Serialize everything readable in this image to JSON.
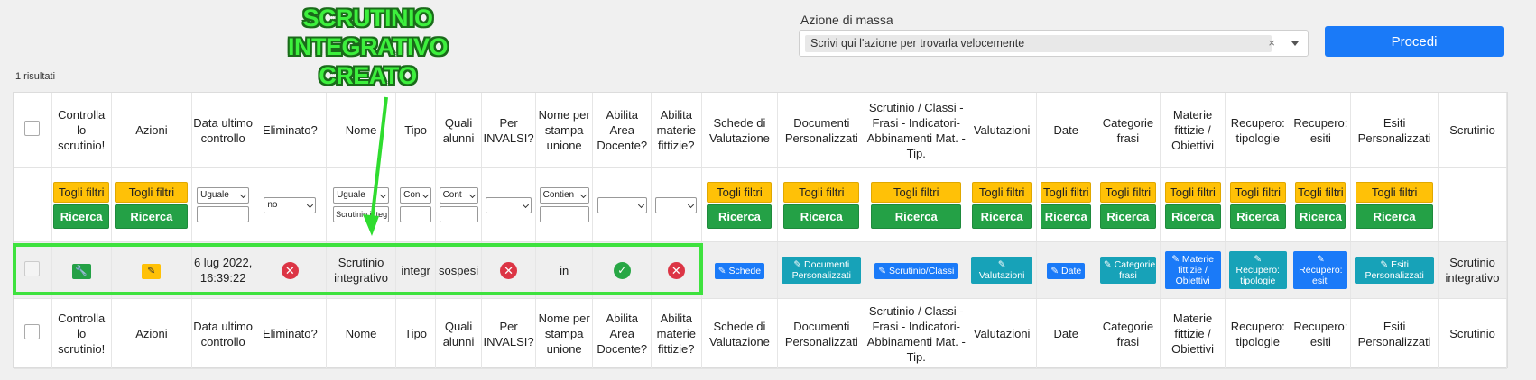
{
  "mass_action": {
    "label": "Azione di massa",
    "placeholder": "Scrivi qui l'azione per trovarla velocemente",
    "clear_symbol": "×",
    "proceed_label": "Procedi"
  },
  "results_count": "1 risultati",
  "annotation": {
    "lines": [
      "SCRUTINIO",
      "INTEGRATIVO",
      "CREATO"
    ],
    "color": "#3df03d"
  },
  "columns": [
    {
      "key": "check",
      "label": ""
    },
    {
      "key": "controlla",
      "label": "Controlla lo scrutinio!"
    },
    {
      "key": "azioni",
      "label": "Azioni"
    },
    {
      "key": "data",
      "label": "Data ultimo controllo"
    },
    {
      "key": "eliminato",
      "label": "Eliminato?"
    },
    {
      "key": "nome",
      "label": "Nome"
    },
    {
      "key": "tipo",
      "label": "Tipo"
    },
    {
      "key": "quali",
      "label": "Quali alunni"
    },
    {
      "key": "invalsi",
      "label": "Per INVALSI?"
    },
    {
      "key": "nome_stampa",
      "label": "Nome per stampa unione"
    },
    {
      "key": "area",
      "label": "Abilita Area Docente?"
    },
    {
      "key": "materie",
      "label": "Abilita materie fittizie?"
    },
    {
      "key": "schede",
      "label": "Schede di Valutazione"
    },
    {
      "key": "documenti",
      "label": "Documenti Personalizzati"
    },
    {
      "key": "classi",
      "label": "Scrutinio / Classi - Frasi - Indicatori- Abbinamenti Mat. - Tip."
    },
    {
      "key": "valutazioni",
      "label": "Valutazioni"
    },
    {
      "key": "date",
      "label": "Date"
    },
    {
      "key": "categorie",
      "label": "Categorie frasi"
    },
    {
      "key": "materie_fitt",
      "label": "Materie fittizie / Obiettivi"
    },
    {
      "key": "rec_tip",
      "label": "Recupero: tipologie"
    },
    {
      "key": "rec_esiti",
      "label": "Recupero: esiti"
    },
    {
      "key": "esiti",
      "label": "Esiti Personalizzati"
    },
    {
      "key": "scrutinio",
      "label": "Scrutinio"
    }
  ],
  "footer_labels": {
    "classi": "Scrutinio / Classi - Frasi - Indicatori- Abbinamenti Mat. - Tip."
  },
  "filters": {
    "remove_label": "Togli filtri",
    "search_label": "Ricerca",
    "data_op": "Uguale",
    "eliminato": "no",
    "nome_op": "Uguale",
    "nome_value": "Scrutinio integ",
    "tipo_op": "Con",
    "quali_op": "Cont",
    "nome_stampa_op": "Contien"
  },
  "row": {
    "data": "6 lug 2022, 16:39:22",
    "nome": "Scrutinio integrativo",
    "tipo": "integr",
    "quali": "sospesi",
    "nome_stampa": "in",
    "schede": "Schede",
    "documenti": "Documenti Personalizzati",
    "classi": "Scrutinio/Classi",
    "valutazioni": "Valutazioni",
    "date": "Date",
    "categorie": "Categorie frasi",
    "materie_fitt": "Materie fittizie / Obiettivi",
    "rec_tip": "Recupero: tipologie",
    "rec_esiti": "Recupero: esiti",
    "esiti": "Esiti Personalizzati",
    "scrutinio": "Scrutinio integrativo"
  },
  "colors": {
    "primary": "#1a7af8",
    "warning": "#ffc107",
    "success": "#24a146",
    "danger": "#dc3545",
    "info": "#17a2b8"
  }
}
